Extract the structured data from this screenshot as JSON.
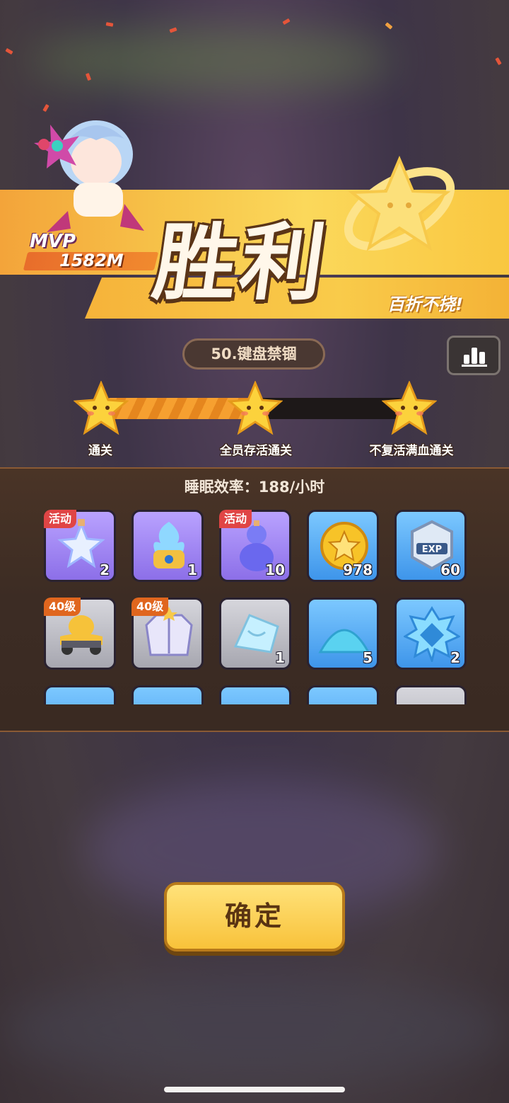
{
  "result": {
    "title": "胜利",
    "motto": "百折不挠!",
    "mvp_label": "MVP",
    "mvp_score": "1582M"
  },
  "level": {
    "name": "50.键盘禁锢"
  },
  "progress": {
    "fraction": 0.5,
    "stars": [
      {
        "label": "通关",
        "achieved": true
      },
      {
        "label": "全员存活通关",
        "achieved": true
      },
      {
        "label": "不复活满血通关",
        "achieved": false
      }
    ]
  },
  "rewards": {
    "title": "睡眠效率：188/小时",
    "items": [
      {
        "icon": "star-bottle-icon",
        "rarity": "purple",
        "tag": "活动",
        "qty": "2"
      },
      {
        "icon": "blue-flame-core-icon",
        "rarity": "purple",
        "tag": "",
        "qty": "1"
      },
      {
        "icon": "gourd-icon",
        "rarity": "purple",
        "tag": "活动",
        "qty": "10"
      },
      {
        "icon": "gold-coin-icon",
        "rarity": "blue",
        "tag": "",
        "qty": "978"
      },
      {
        "icon": "exp-badge-icon",
        "rarity": "blue",
        "tag": "",
        "qty": "60",
        "badge_text": "EXP"
      },
      {
        "icon": "duck-car-icon",
        "rarity": "gray",
        "tag": "40级",
        "qty": ""
      },
      {
        "icon": "jacket-icon",
        "rarity": "gray",
        "tag": "40级",
        "qty": ""
      },
      {
        "icon": "ice-shard-icon",
        "rarity": "gray",
        "tag": "",
        "qty": "1"
      },
      {
        "icon": "blue-powder-icon",
        "rarity": "blue",
        "tag": "",
        "qty": "5"
      },
      {
        "icon": "blue-crystal-icon",
        "rarity": "blue",
        "tag": "",
        "qty": "2"
      }
    ]
  },
  "confirm_label": "确定",
  "colors": {
    "accent": "#f8c23a",
    "panel": "#3c2c24",
    "purple_rarity": "#8c6fe8",
    "blue_rarity": "#3e95ea",
    "gray_rarity": "#a7a7b0"
  }
}
